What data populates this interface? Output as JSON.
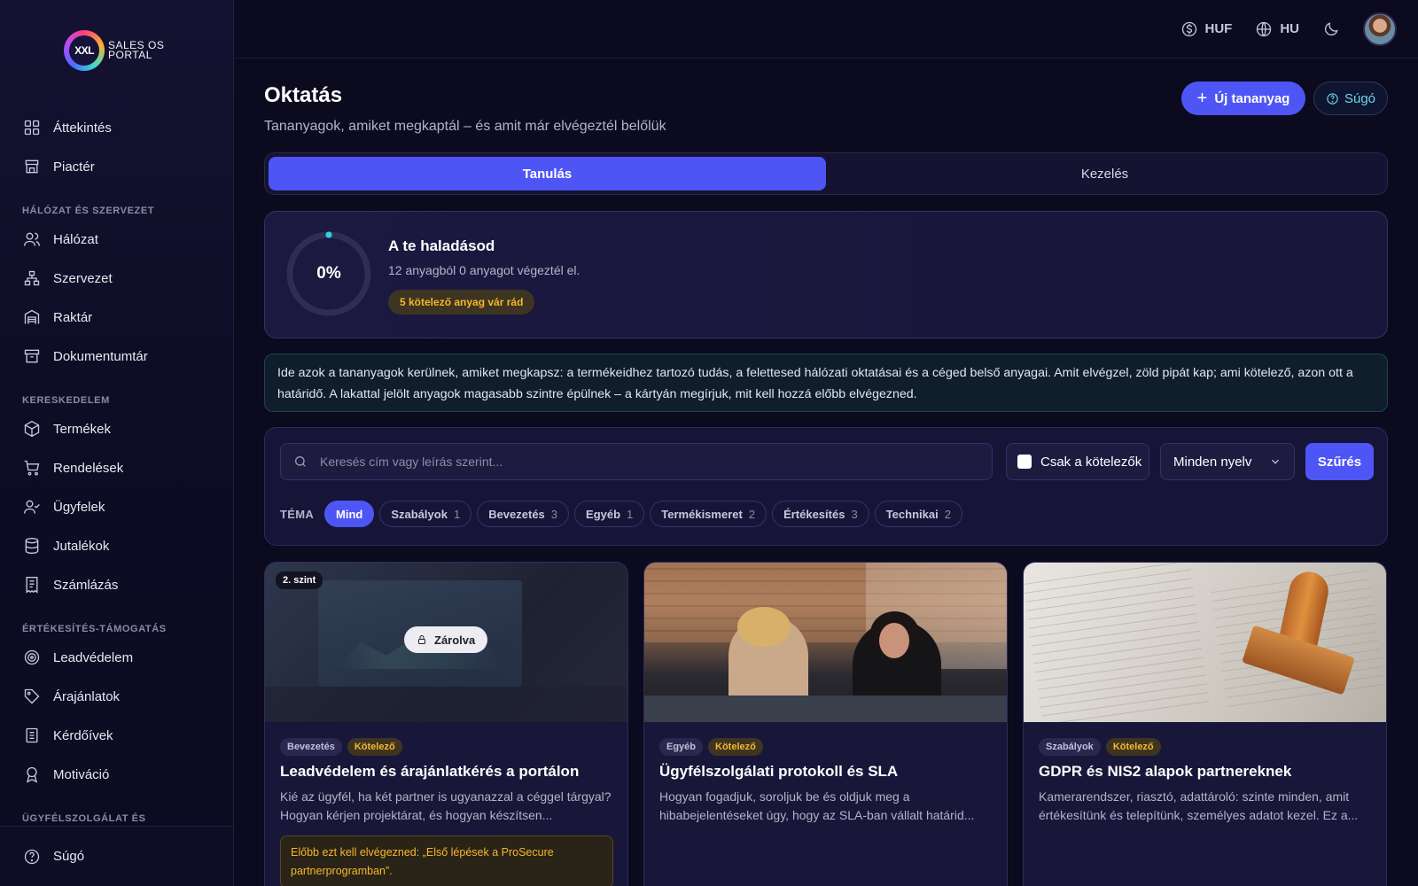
{
  "app": {
    "logo_mark": "XXL",
    "logo_text_line1": "SALES OS",
    "logo_text_line2": "PORTAL"
  },
  "sidebar": {
    "items_top": [
      {
        "label": "Áttekintés",
        "icon": "grid-icon"
      },
      {
        "label": "Piactér",
        "icon": "store-icon"
      }
    ],
    "sections": [
      {
        "title": "HÁLÓZAT ÉS SZERVEZET",
        "items": [
          {
            "label": "Hálózat",
            "icon": "users-icon"
          },
          {
            "label": "Szervezet",
            "icon": "org-chart-icon"
          },
          {
            "label": "Raktár",
            "icon": "warehouse-icon"
          },
          {
            "label": "Dokumentumtár",
            "icon": "archive-icon"
          }
        ]
      },
      {
        "title": "KERESKEDELEM",
        "items": [
          {
            "label": "Termékek",
            "icon": "box-icon"
          },
          {
            "label": "Rendelések",
            "icon": "cart-icon"
          },
          {
            "label": "Ügyfelek",
            "icon": "user-check-icon"
          },
          {
            "label": "Jutalékok",
            "icon": "database-icon"
          },
          {
            "label": "Számlázás",
            "icon": "receipt-icon"
          }
        ]
      },
      {
        "title": "ÉRTÉKESÍTÉS-TÁMOGATÁS",
        "items": [
          {
            "label": "Leadvédelem",
            "icon": "target-icon"
          },
          {
            "label": "Árajánlatok",
            "icon": "tag-icon"
          },
          {
            "label": "Kérdőívek",
            "icon": "clipboard-icon"
          },
          {
            "label": "Motiváció",
            "icon": "award-icon"
          }
        ]
      },
      {
        "title": "ÜGYFÉLSZOLGÁLAT ÉS",
        "items": []
      }
    ],
    "footer": {
      "label": "Súgó",
      "icon": "help-circle-icon"
    }
  },
  "topbar": {
    "currency": "HUF",
    "language": "HU"
  },
  "page": {
    "title": "Oktatás",
    "subtitle": "Tananyagok, amiket megkaptál – és amit már elvégeztél belőlük",
    "new_button": "Új tananyag",
    "help_button": "Súgó",
    "tabs": [
      {
        "label": "Tanulás",
        "active": true
      },
      {
        "label": "Kezelés",
        "active": false
      }
    ]
  },
  "progress": {
    "percent_label": "0%",
    "percent": 0,
    "title": "A te haladásod",
    "summary": "12 anyagból 0 anyagot végeztél el.",
    "badge": "5 kötelező anyag vár rád"
  },
  "info": {
    "text": "Ide azok a tananyagok kerülnek, amiket megkapsz: a termékeidhez tartozó tudás, a felettesed hálózati oktatásai és a céged belső anyagai. Amit elvégzel, zöld pipát kap; ami kötelező, azon ott a határidő. A lakattal jelölt anyagok magasabb szintre épülnek – a kártyán megírjuk, mit kell hozzá előbb elvégezned."
  },
  "filters": {
    "search_placeholder": "Keresés cím vagy leírás szerint...",
    "only_required": "Csak a kötelezők",
    "language_select": "Minden nyelv",
    "filter_button": "Szűrés",
    "topic_label": "TÉMA",
    "topics": [
      {
        "label": "Mind",
        "count": "",
        "active": true
      },
      {
        "label": "Szabályok",
        "count": "1"
      },
      {
        "label": "Bevezetés",
        "count": "3"
      },
      {
        "label": "Egyéb",
        "count": "1"
      },
      {
        "label": "Termékismeret",
        "count": "2"
      },
      {
        "label": "Értékesítés",
        "count": "3"
      },
      {
        "label": "Technikai",
        "count": "2"
      }
    ]
  },
  "cards": [
    {
      "level": "2. szint",
      "locked_label": "Zárolva",
      "category": "Bevezetés",
      "required": "Kötelező",
      "title": "Leadvédelem és árajánlatkérés a portálon",
      "description": "Kié az ügyfél, ha két partner is ugyanazzal a céggel tárgyal? Hogyan kérjen projektárat, és hogyan készítsen...",
      "prerequisite": "Előbb ezt kell elvégezned: „Első lépések a ProSecure partnerprogramban”."
    },
    {
      "category": "Egyéb",
      "required": "Kötelező",
      "title": "Ügyfélszolgálati protokoll és SLA",
      "description": "Hogyan fogadjuk, soroljuk be és oldjuk meg a hibabejelentéseket úgy, hogy az SLA-ban vállalt határid..."
    },
    {
      "category": "Szabályok",
      "required": "Kötelező",
      "title": "GDPR és NIS2 alapok partnereknek",
      "description": "Kamerarendszer, riasztó, adattároló: szinte minden, amit értékesítünk és telepítünk, személyes adatot kezel. Ez a..."
    }
  ],
  "colors": {
    "accent": "#4e55f5",
    "warning": "#f5b82a",
    "teal": "#6fd6e8"
  }
}
